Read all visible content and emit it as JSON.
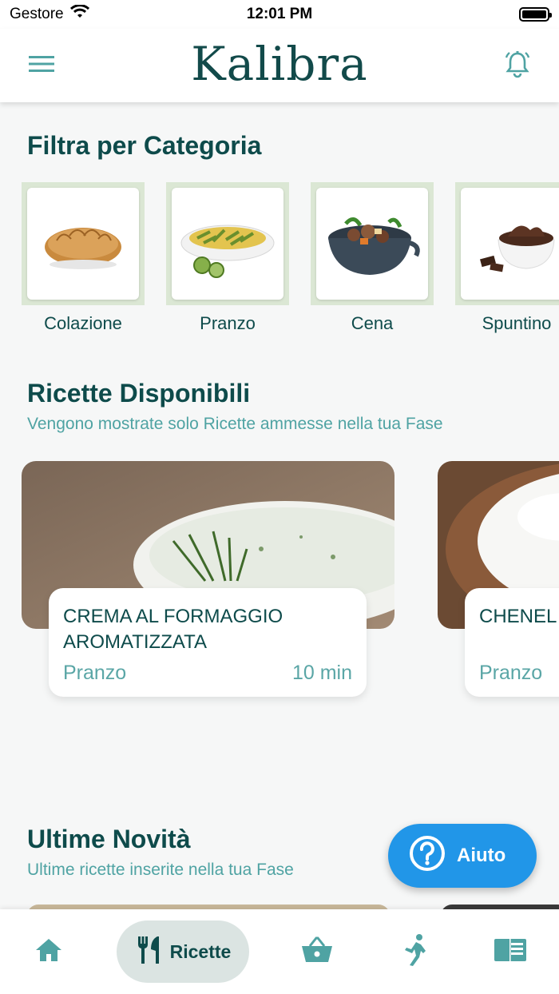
{
  "status": {
    "carrier": "Gestore",
    "time": "12:01 PM"
  },
  "header": {
    "brand": "Kalibra"
  },
  "categories_section": {
    "title": "Filtra per Categoria",
    "items": [
      {
        "label": "Colazione",
        "icon": "croissant-image"
      },
      {
        "label": "Pranzo",
        "icon": "pasta-image"
      },
      {
        "label": "Cena",
        "icon": "stew-image"
      },
      {
        "label": "Spuntino",
        "icon": "chocolate-pudding-image"
      }
    ]
  },
  "available_section": {
    "title": "Ricette Disponibili",
    "subtitle": "Vengono mostrate solo Ricette ammesse nella tua Fase",
    "recipes": [
      {
        "title": "CREMA AL FORMAGGIO AROMATIZZATA",
        "category": "Pranzo",
        "time": "10 min"
      },
      {
        "title": "CHENEL FORMAG",
        "category": "Pranzo",
        "time": ""
      }
    ]
  },
  "news_section": {
    "title": "Ultime Novità",
    "subtitle": "Ultime ricette inserite nella tua Fase"
  },
  "help": {
    "label": "Aiuto"
  },
  "nav": {
    "items": [
      {
        "name": "home",
        "icon": "home-icon"
      },
      {
        "name": "recipes",
        "icon": "cutlery-icon",
        "label": "Ricette",
        "active": true
      },
      {
        "name": "basket",
        "icon": "basket-icon"
      },
      {
        "name": "activity",
        "icon": "runner-icon"
      },
      {
        "name": "diary",
        "icon": "book-icon"
      }
    ]
  },
  "colors": {
    "primary": "#0e4b4b",
    "accent": "#4fa3a3",
    "help": "#2196e8",
    "category_frame": "#dbe7d4"
  }
}
